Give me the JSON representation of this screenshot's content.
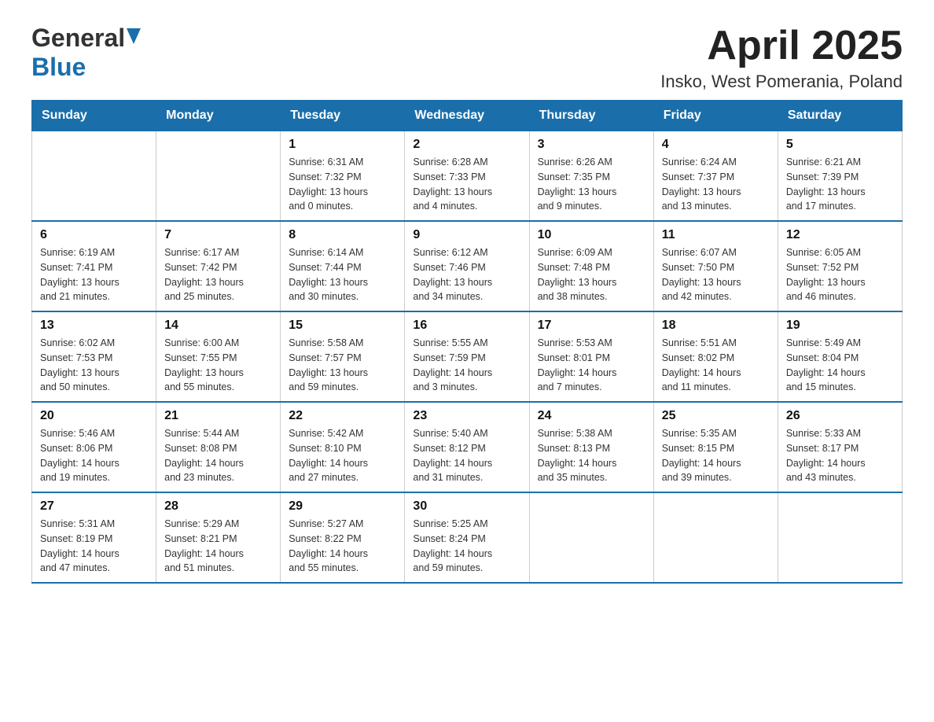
{
  "header": {
    "title": "April 2025",
    "subtitle": "Insko, West Pomerania, Poland",
    "logo_general": "General",
    "logo_blue": "Blue"
  },
  "calendar": {
    "days_of_week": [
      "Sunday",
      "Monday",
      "Tuesday",
      "Wednesday",
      "Thursday",
      "Friday",
      "Saturday"
    ],
    "weeks": [
      [
        {
          "day": "",
          "info": ""
        },
        {
          "day": "",
          "info": ""
        },
        {
          "day": "1",
          "info": "Sunrise: 6:31 AM\nSunset: 7:32 PM\nDaylight: 13 hours\nand 0 minutes."
        },
        {
          "day": "2",
          "info": "Sunrise: 6:28 AM\nSunset: 7:33 PM\nDaylight: 13 hours\nand 4 minutes."
        },
        {
          "day": "3",
          "info": "Sunrise: 6:26 AM\nSunset: 7:35 PM\nDaylight: 13 hours\nand 9 minutes."
        },
        {
          "day": "4",
          "info": "Sunrise: 6:24 AM\nSunset: 7:37 PM\nDaylight: 13 hours\nand 13 minutes."
        },
        {
          "day": "5",
          "info": "Sunrise: 6:21 AM\nSunset: 7:39 PM\nDaylight: 13 hours\nand 17 minutes."
        }
      ],
      [
        {
          "day": "6",
          "info": "Sunrise: 6:19 AM\nSunset: 7:41 PM\nDaylight: 13 hours\nand 21 minutes."
        },
        {
          "day": "7",
          "info": "Sunrise: 6:17 AM\nSunset: 7:42 PM\nDaylight: 13 hours\nand 25 minutes."
        },
        {
          "day": "8",
          "info": "Sunrise: 6:14 AM\nSunset: 7:44 PM\nDaylight: 13 hours\nand 30 minutes."
        },
        {
          "day": "9",
          "info": "Sunrise: 6:12 AM\nSunset: 7:46 PM\nDaylight: 13 hours\nand 34 minutes."
        },
        {
          "day": "10",
          "info": "Sunrise: 6:09 AM\nSunset: 7:48 PM\nDaylight: 13 hours\nand 38 minutes."
        },
        {
          "day": "11",
          "info": "Sunrise: 6:07 AM\nSunset: 7:50 PM\nDaylight: 13 hours\nand 42 minutes."
        },
        {
          "day": "12",
          "info": "Sunrise: 6:05 AM\nSunset: 7:52 PM\nDaylight: 13 hours\nand 46 minutes."
        }
      ],
      [
        {
          "day": "13",
          "info": "Sunrise: 6:02 AM\nSunset: 7:53 PM\nDaylight: 13 hours\nand 50 minutes."
        },
        {
          "day": "14",
          "info": "Sunrise: 6:00 AM\nSunset: 7:55 PM\nDaylight: 13 hours\nand 55 minutes."
        },
        {
          "day": "15",
          "info": "Sunrise: 5:58 AM\nSunset: 7:57 PM\nDaylight: 13 hours\nand 59 minutes."
        },
        {
          "day": "16",
          "info": "Sunrise: 5:55 AM\nSunset: 7:59 PM\nDaylight: 14 hours\nand 3 minutes."
        },
        {
          "day": "17",
          "info": "Sunrise: 5:53 AM\nSunset: 8:01 PM\nDaylight: 14 hours\nand 7 minutes."
        },
        {
          "day": "18",
          "info": "Sunrise: 5:51 AM\nSunset: 8:02 PM\nDaylight: 14 hours\nand 11 minutes."
        },
        {
          "day": "19",
          "info": "Sunrise: 5:49 AM\nSunset: 8:04 PM\nDaylight: 14 hours\nand 15 minutes."
        }
      ],
      [
        {
          "day": "20",
          "info": "Sunrise: 5:46 AM\nSunset: 8:06 PM\nDaylight: 14 hours\nand 19 minutes."
        },
        {
          "day": "21",
          "info": "Sunrise: 5:44 AM\nSunset: 8:08 PM\nDaylight: 14 hours\nand 23 minutes."
        },
        {
          "day": "22",
          "info": "Sunrise: 5:42 AM\nSunset: 8:10 PM\nDaylight: 14 hours\nand 27 minutes."
        },
        {
          "day": "23",
          "info": "Sunrise: 5:40 AM\nSunset: 8:12 PM\nDaylight: 14 hours\nand 31 minutes."
        },
        {
          "day": "24",
          "info": "Sunrise: 5:38 AM\nSunset: 8:13 PM\nDaylight: 14 hours\nand 35 minutes."
        },
        {
          "day": "25",
          "info": "Sunrise: 5:35 AM\nSunset: 8:15 PM\nDaylight: 14 hours\nand 39 minutes."
        },
        {
          "day": "26",
          "info": "Sunrise: 5:33 AM\nSunset: 8:17 PM\nDaylight: 14 hours\nand 43 minutes."
        }
      ],
      [
        {
          "day": "27",
          "info": "Sunrise: 5:31 AM\nSunset: 8:19 PM\nDaylight: 14 hours\nand 47 minutes."
        },
        {
          "day": "28",
          "info": "Sunrise: 5:29 AM\nSunset: 8:21 PM\nDaylight: 14 hours\nand 51 minutes."
        },
        {
          "day": "29",
          "info": "Sunrise: 5:27 AM\nSunset: 8:22 PM\nDaylight: 14 hours\nand 55 minutes."
        },
        {
          "day": "30",
          "info": "Sunrise: 5:25 AM\nSunset: 8:24 PM\nDaylight: 14 hours\nand 59 minutes."
        },
        {
          "day": "",
          "info": ""
        },
        {
          "day": "",
          "info": ""
        },
        {
          "day": "",
          "info": ""
        }
      ]
    ]
  }
}
